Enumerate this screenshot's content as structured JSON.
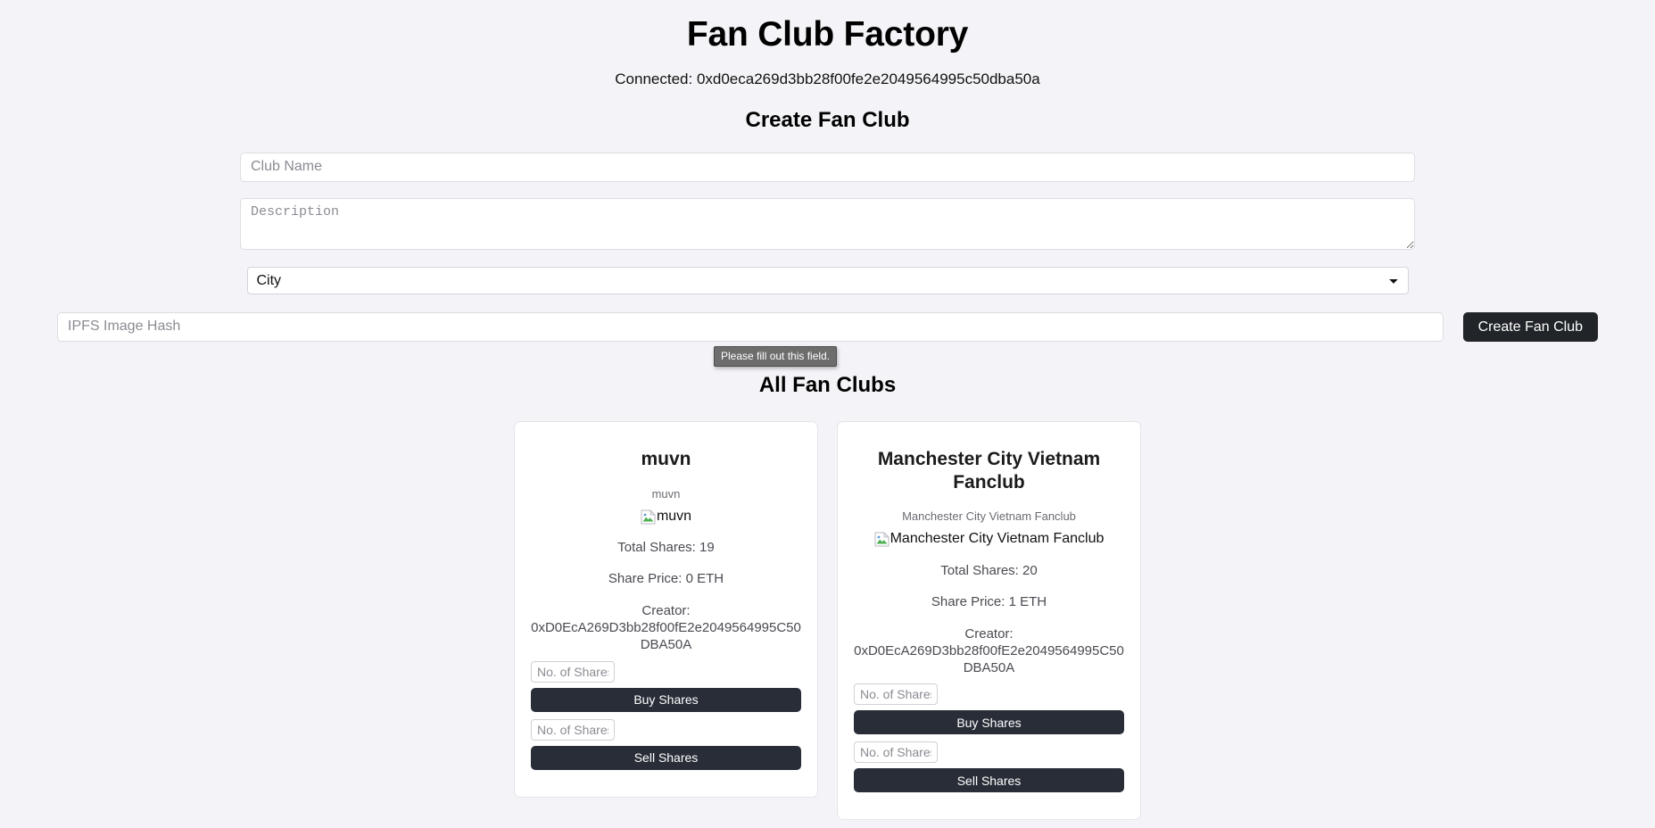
{
  "header": {
    "app_title": "Fan Club Factory",
    "connected_label": "Connected: 0xd0eca269d3bb28f00fe2e2049564995c50dba50a"
  },
  "create_form": {
    "section_title": "Create Fan Club",
    "club_name_placeholder": "Club Name",
    "club_name_value": "",
    "description_placeholder": "Description",
    "description_value": "",
    "city_selected": "City",
    "city_options": [
      "City"
    ],
    "ipfs_placeholder": "IPFS Image Hash",
    "ipfs_value": "",
    "submit_label": "Create Fan Club",
    "validation_tooltip": "Please fill out this field."
  },
  "clubs_section": {
    "title": "All Fan Clubs",
    "cards": [
      {
        "name": "muvn",
        "description": "muvn",
        "image_alt": "muvn",
        "image_icon": "broken-image-icon",
        "total_shares": "Total Shares: 19",
        "share_price": "Share Price: 0 ETH",
        "creator_label": "Creator:",
        "creator_address": "0xD0EcA269D3bb28f00fE2e2049564995C50DBA50A",
        "buy_input_placeholder": "No. of Shares",
        "buy_input_value": "",
        "buy_label": "Buy Shares",
        "sell_input_placeholder": "No. of Shares",
        "sell_input_value": "",
        "sell_label": "Sell Shares"
      },
      {
        "name": "Manchester City Vietnam Fanclub",
        "description": "Manchester City Vietnam Fanclub",
        "image_alt": "Manchester City Vietnam Fanclub",
        "image_icon": "broken-image-icon",
        "total_shares": "Total Shares: 20",
        "share_price": "Share Price: 1 ETH",
        "creator_label": "Creator:",
        "creator_address": "0xD0EcA269D3bb28f00fE2e2049564995C50DBA50A",
        "buy_input_placeholder": "No. of Shares",
        "buy_input_value": "",
        "buy_label": "Buy Shares",
        "sell_input_placeholder": "No. of Shares",
        "sell_input_value": "",
        "sell_label": "Sell Shares"
      }
    ]
  },
  "colors": {
    "page_background": "#f4f4f8",
    "button_dark": "#282d37",
    "submit_dark": "#212529",
    "tooltip_background": "#6d6d6d",
    "card_background": "#ffffff",
    "muted_text": "#6b6b73"
  }
}
